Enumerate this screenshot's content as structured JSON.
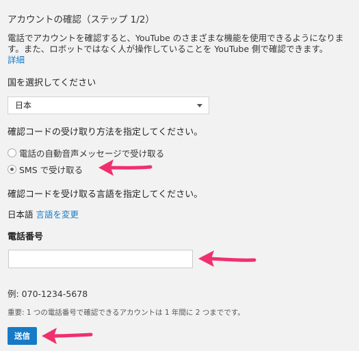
{
  "title": "アカウントの確認（ステップ 1/2）",
  "description": {
    "line1": "電話でアカウントを確認すると、YouTube のさまざまな機能を使用できるようになりま",
    "line2": "す。また、ロボットではなく人が操作していることを YouTube 側で確認できます。",
    "details_link": "詳細"
  },
  "country": {
    "label": "国を選択してください",
    "selected": "日本"
  },
  "method": {
    "label": "確認コードの受け取り方法を指定してください。",
    "options": [
      {
        "label": "電話の自動音声メッセージで受け取る",
        "checked": false
      },
      {
        "label": "SMS で受け取る",
        "checked": true
      }
    ]
  },
  "language": {
    "label": "確認コードを受け取る言語を指定してください。",
    "current": "日本語",
    "change_link": "言語を変更"
  },
  "phone": {
    "label": "電話番号",
    "value": "",
    "example": "例: 070-1234-5678"
  },
  "note": "重要: 1 つの電話番号で確認できるアカウントは 1 年間に 2 つまでです。",
  "submit_label": "送信",
  "colors": {
    "link": "#167ac6",
    "button": "#167ac6",
    "annotation_arrow": "#f0306e",
    "background": "#f2f2f2"
  }
}
